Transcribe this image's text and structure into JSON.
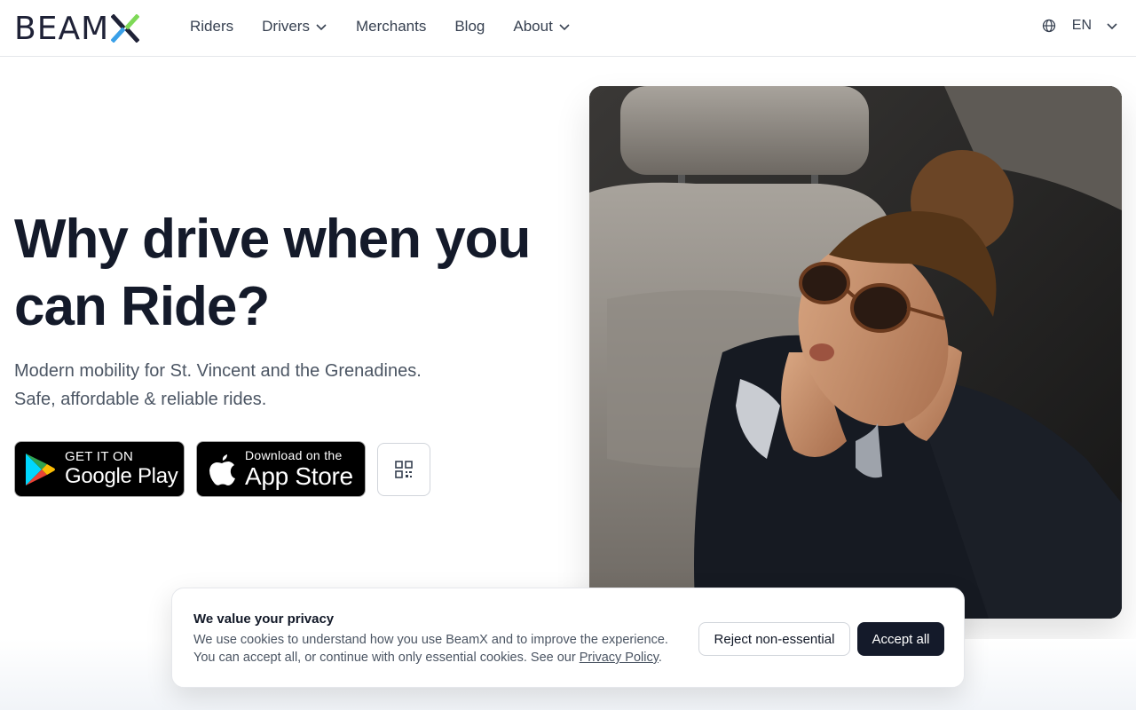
{
  "header": {
    "logo_text": "BEAM",
    "nav": [
      {
        "label": "Riders",
        "has_dropdown": false
      },
      {
        "label": "Drivers",
        "has_dropdown": true
      },
      {
        "label": "Merchants",
        "has_dropdown": false
      },
      {
        "label": "Blog",
        "has_dropdown": false
      },
      {
        "label": "About",
        "has_dropdown": true
      }
    ],
    "language": "EN",
    "icons": {
      "language": "globe-icon",
      "dropdown": "chevron-down-icon"
    }
  },
  "hero": {
    "title": "Why drive when you can Ride?",
    "subtitle_line1": "Modern mobility for St. Vincent and the Grenadines.",
    "subtitle_line2": "Safe, affordable & reliable rides.",
    "google_play": {
      "small": "GET IT ON",
      "big": "Google Play"
    },
    "app_store": {
      "small": "Download on the",
      "big": "App Store"
    },
    "qr_icon": "qr-code-icon"
  },
  "cookie_banner": {
    "title": "We value your privacy",
    "text_before_link": "We use cookies to understand how you use BeamX and to improve the experience. You can accept all, or continue with only essential cookies. See our ",
    "link_text": "Privacy Policy",
    "text_after_link": ".",
    "reject_label": "Reject non-essential",
    "accept_label": "Accept all"
  },
  "colors": {
    "brand_dark": "#141a2a",
    "logo_x_green": "#7ed957",
    "logo_x_blue": "#3aa0e8",
    "text_muted": "#4b5563"
  }
}
